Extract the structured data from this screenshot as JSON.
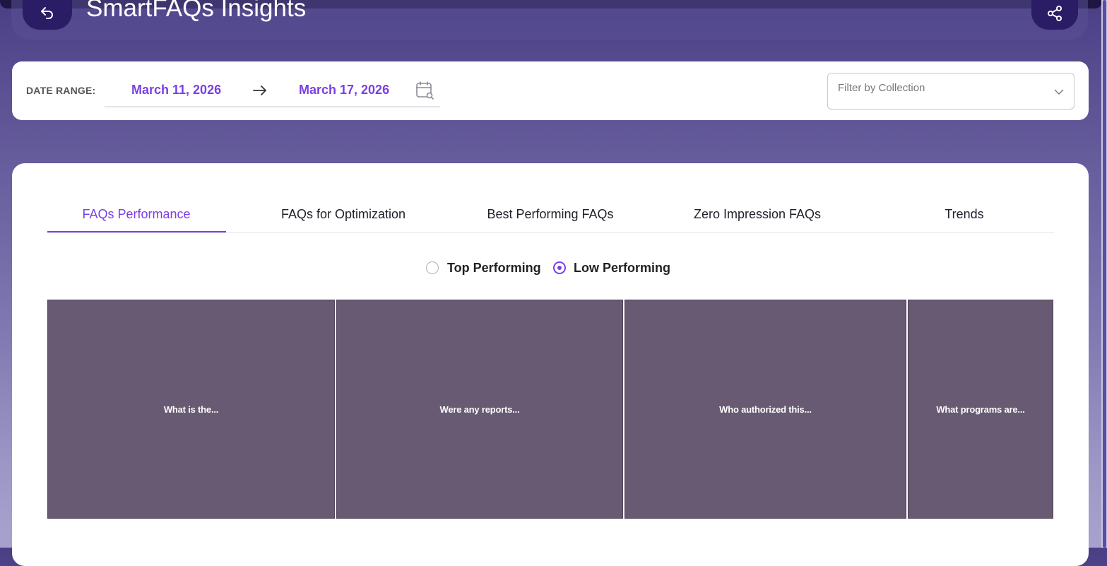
{
  "header": {
    "title": "SmartFAQs Insights"
  },
  "filters": {
    "date_range_label": "DATE RANGE:",
    "date_from": "March 11, 2026",
    "date_to": "March 17, 2026",
    "collection_placeholder": "Filter by Collection"
  },
  "tabs": [
    {
      "label": "FAQs Performance",
      "active": true
    },
    {
      "label": "FAQs for Optimization",
      "active": false
    },
    {
      "label": "Best Performing FAQs",
      "active": false
    },
    {
      "label": "Zero Impression FAQs",
      "active": false
    },
    {
      "label": "Trends",
      "active": false
    }
  ],
  "performance_toggle": {
    "options": [
      "Top Performing",
      "Low Performing"
    ],
    "selected": "Low Performing"
  },
  "chart_data": {
    "type": "treemap",
    "items": [
      {
        "label": "What is the..."
      },
      {
        "label": "Were any reports..."
      },
      {
        "label": "Who authorized this..."
      },
      {
        "label": "What programs are..."
      }
    ]
  },
  "colors": {
    "accent": "#7b3fe4",
    "tile": "#675a72",
    "header_dark": "#2b1c66"
  }
}
